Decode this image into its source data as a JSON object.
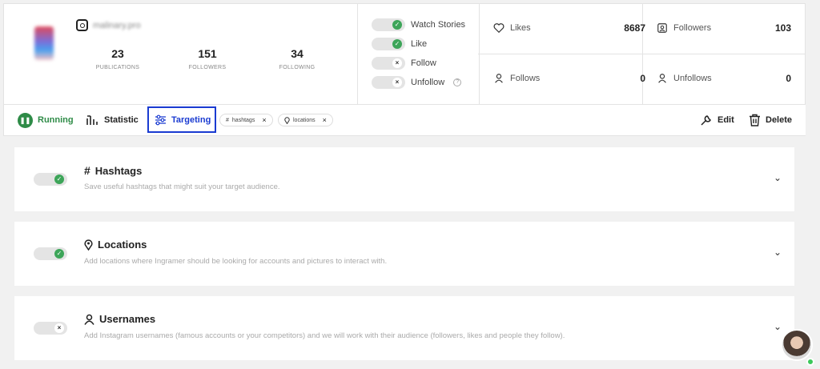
{
  "profile": {
    "username": "malinary.pro",
    "stats": [
      {
        "value": "23",
        "label": "PUBLICATIONS"
      },
      {
        "value": "151",
        "label": "FOLLOWERS"
      },
      {
        "value": "34",
        "label": "FOLLOWING"
      }
    ]
  },
  "actions": [
    {
      "label": "Watch Stories",
      "enabled": true
    },
    {
      "label": "Like",
      "enabled": true
    },
    {
      "label": "Follow",
      "enabled": false
    },
    {
      "label": "Unfollow",
      "enabled": false,
      "help": "?"
    }
  ],
  "counters": {
    "likes": {
      "label": "Likes",
      "value": "8687",
      "icon": "heart-icon"
    },
    "followers": {
      "label": "Followers",
      "value": "103",
      "icon": "followers-icon"
    },
    "follows": {
      "label": "Follows",
      "value": "0",
      "icon": "follow-user-icon"
    },
    "unfollows": {
      "label": "Unfollows",
      "value": "0",
      "icon": "unfollow-user-icon"
    }
  },
  "tabs": {
    "running": "Running",
    "statistic": "Statistic",
    "targeting": "Targeting",
    "edit": "Edit",
    "delete": "Delete"
  },
  "chips": [
    {
      "label": "hashtags",
      "icon": "#"
    },
    {
      "label": "locations",
      "icon": "pin"
    }
  ],
  "sections": [
    {
      "title": "Hashtags",
      "description": "Save useful hashtags that might suit your target audience.",
      "enabled": true
    },
    {
      "title": "Locations",
      "description": "Add locations where Ingramer should be looking for accounts and pictures to interact with.",
      "enabled": true
    },
    {
      "title": "Usernames",
      "description": "Add Instagram usernames (famous accounts or your competitors) and we will work with their audience (followers, likes and people they follow).",
      "enabled": false
    }
  ],
  "colors": {
    "accent_green": "#2e8b47",
    "toggle_green": "#3da559",
    "targeting_blue": "#1a3bd1"
  }
}
